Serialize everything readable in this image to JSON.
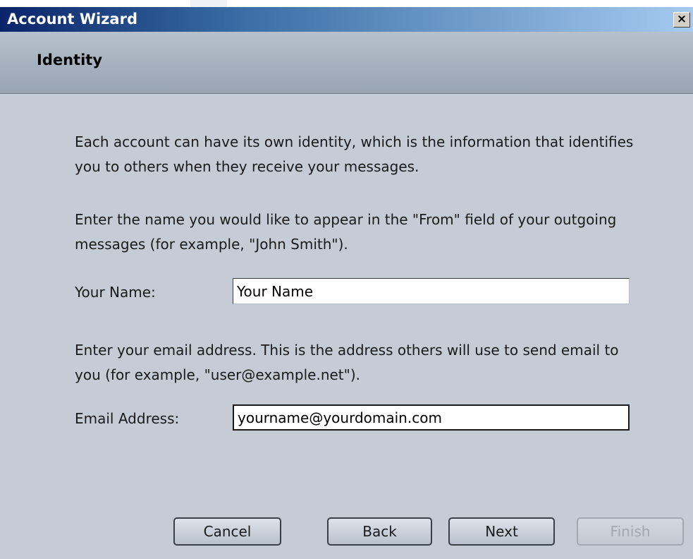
{
  "window": {
    "title": "Account Wizard",
    "close_glyph": "×"
  },
  "header": {
    "title": "Identity"
  },
  "content": {
    "intro_text": "Each account can have its own identity, which is the information that identifies you to others when they receive your messages.",
    "name_instructions": "Enter the name you would like to appear in the \"From\" field of your outgoing messages (for example, \"John Smith\").",
    "name_label": "Your Name:",
    "name_value": "Your Name",
    "email_instructions": "Enter your email address. This is the address others will use to send email to you (for example, \"user@example.net\").",
    "email_label": "Email Address:",
    "email_value": "yourname@yourdomain.com"
  },
  "buttons": {
    "cancel_label": "Cancel",
    "back_label": "Back",
    "next_label": "Next",
    "finish_label": "Finish"
  },
  "colors": {
    "dialog_background": "#c6ccd6",
    "titlebar_start": "#0a246a",
    "titlebar_end": "#a6caf0",
    "header_background": "#a7b2bf",
    "disabled_text": "#a3a8b0"
  }
}
